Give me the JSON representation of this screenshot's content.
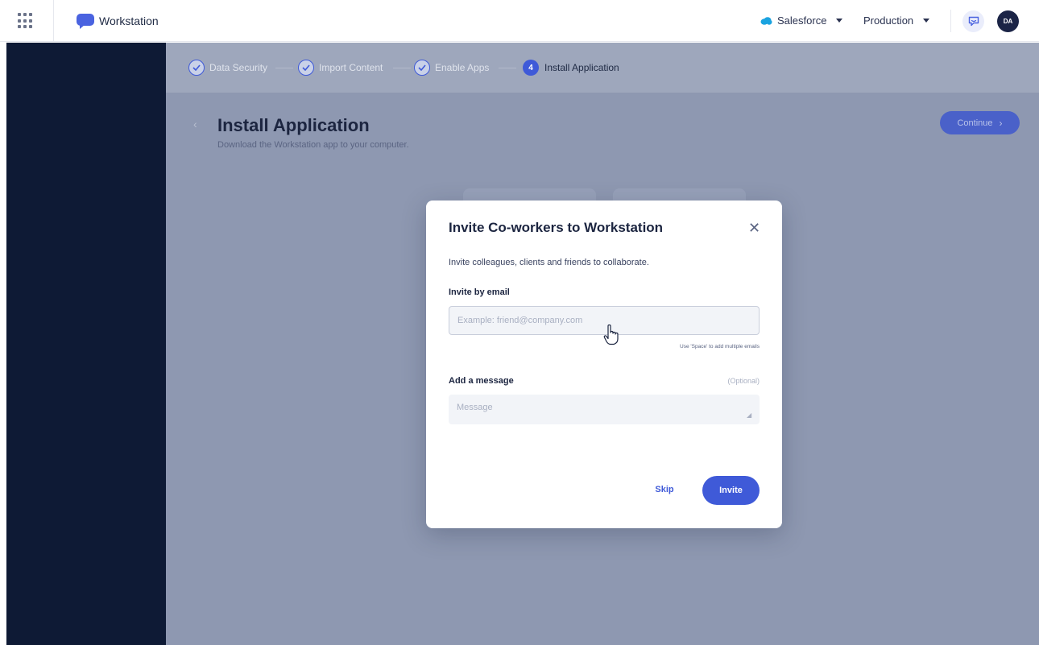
{
  "topbar": {
    "app_name": "Workstation",
    "org": "Salesforce",
    "environment": "Production",
    "avatar_initials": "DA"
  },
  "stepper": {
    "steps": [
      {
        "label": "Data Security",
        "state": "done"
      },
      {
        "label": "Import Content",
        "state": "done"
      },
      {
        "label": "Enable Apps",
        "state": "done"
      },
      {
        "label": "Install Application",
        "state": "current",
        "number": "4"
      }
    ]
  },
  "page": {
    "title": "Install Application",
    "subtitle": "Download the Workstation app to your computer.",
    "continue_label": "Continue"
  },
  "modal": {
    "title": "Invite Co-workers to Workstation",
    "description": "Invite colleagues, clients and friends to collaborate.",
    "email_label": "Invite by email",
    "email_placeholder": "Example: friend@company.com",
    "email_hint": "Use 'Space' to add multiple emails",
    "message_label": "Add a message",
    "message_optional": "(Optional)",
    "message_placeholder": "Message",
    "skip_label": "Skip",
    "invite_label": "Invite"
  },
  "colors": {
    "accent": "#3f5ad8",
    "sidebar": "#0e1a35",
    "overlay": "#8e98b1"
  },
  "icons": {
    "apps": "grid-icon",
    "logo": "chat-bubble-icon",
    "org": "cloud-icon",
    "chat": "comment-icon",
    "close": "close-icon",
    "cursor": "hand-pointer-icon"
  }
}
